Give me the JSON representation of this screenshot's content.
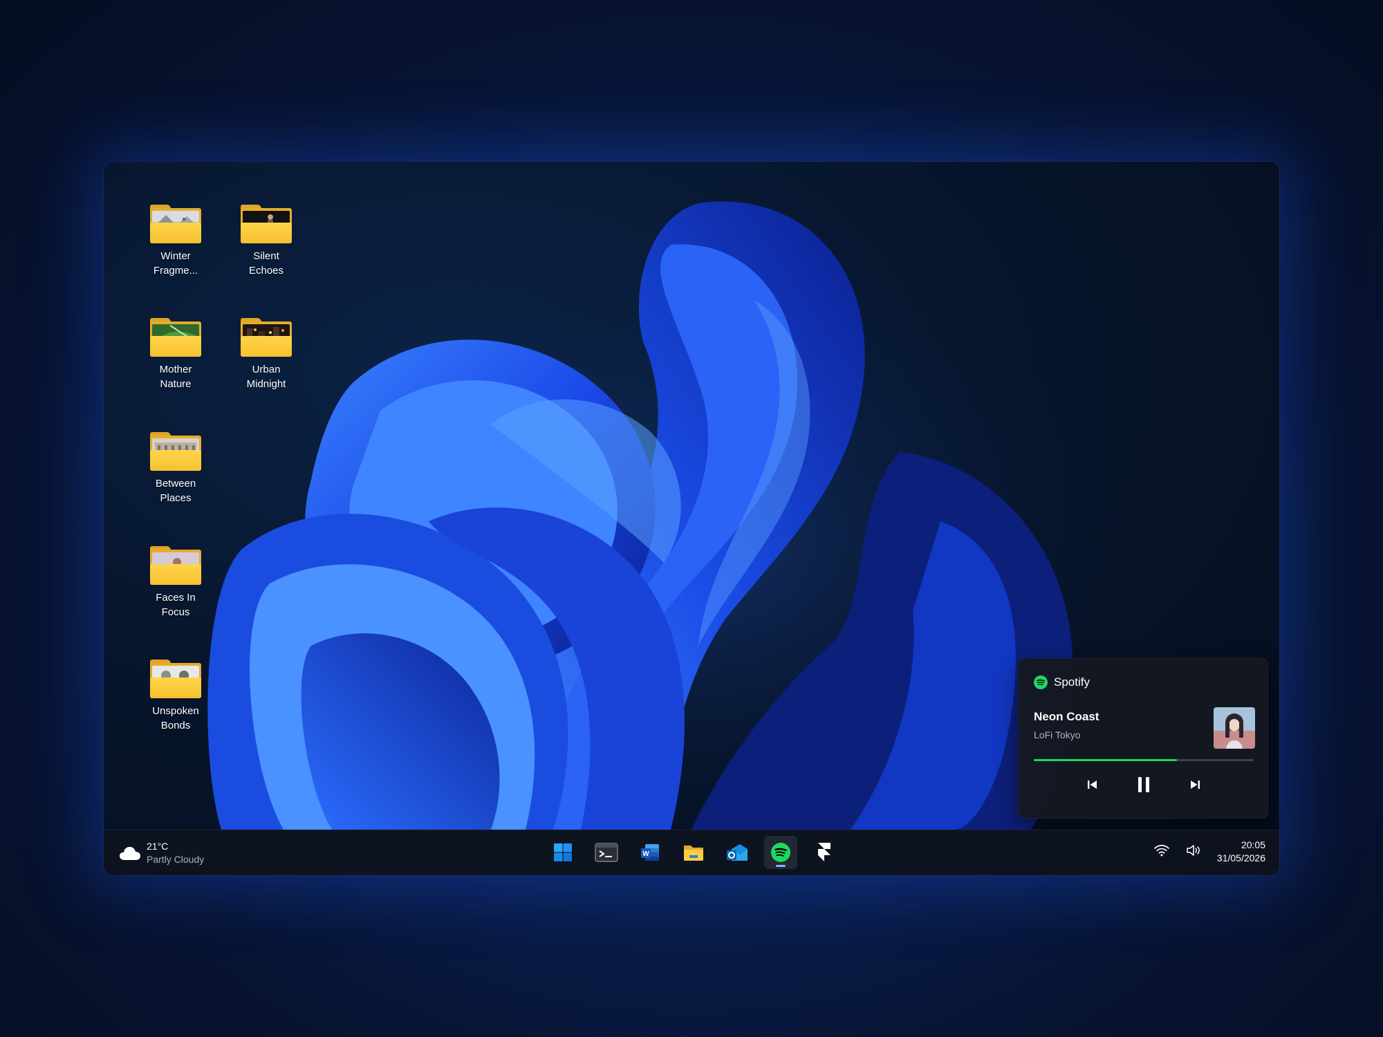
{
  "desktop": {
    "icons": [
      {
        "label": "Winter\nFragme...",
        "photo": "winter"
      },
      {
        "label": "Silent\nEchoes",
        "photo": "silent"
      },
      {
        "label": "Mother\nNature",
        "photo": "nature"
      },
      {
        "label": "Urban\nMidnight",
        "photo": "urban"
      },
      {
        "label": "Between\nPlaces",
        "photo": "places"
      },
      {
        "label": "Faces In\nFocus",
        "photo": "faces"
      },
      {
        "label": "Unspoken\nBonds",
        "photo": "bonds"
      }
    ]
  },
  "taskbar": {
    "weather": {
      "temp": "21°C",
      "desc": "Partly Cloudy",
      "icon": "cloud-icon"
    },
    "apps": [
      {
        "name": "start",
        "icon": "windows-logo-icon",
        "active": false
      },
      {
        "name": "terminal",
        "icon": "terminal-icon",
        "active": false
      },
      {
        "name": "word",
        "icon": "word-icon",
        "active": false
      },
      {
        "name": "file-explorer",
        "icon": "folder-icon",
        "active": false
      },
      {
        "name": "outlook",
        "icon": "outlook-icon",
        "active": false
      },
      {
        "name": "spotify",
        "icon": "spotify-icon",
        "active": true
      },
      {
        "name": "framer",
        "icon": "framer-icon",
        "active": false
      }
    ],
    "tray": {
      "wifi_icon": "wifi-icon",
      "volume_icon": "speaker-icon"
    },
    "clock": {
      "time": "20:05",
      "date": "31/05/2026"
    }
  },
  "player": {
    "app": "Spotify",
    "title": "Neon Coast",
    "artist": "LoFi Tokyo",
    "progress": 0.65,
    "accent": "#1ed760"
  }
}
